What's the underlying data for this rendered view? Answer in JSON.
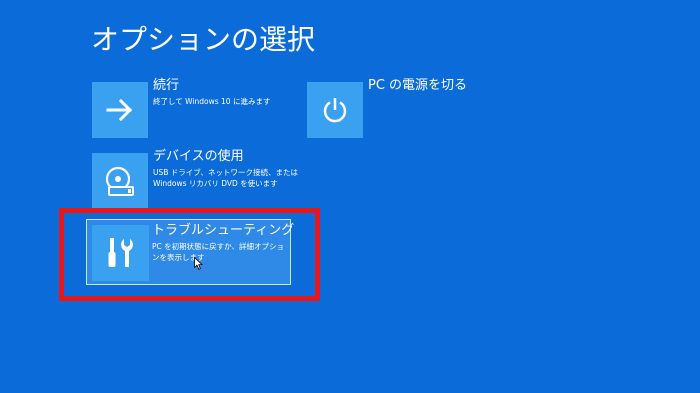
{
  "page": {
    "title": "オプションの選択"
  },
  "options": {
    "continue": {
      "title": "続行",
      "description": "終了して Windows 10 に進みます",
      "icon": "arrow-right-icon"
    },
    "power_off": {
      "title": "PC の電源を切る",
      "icon": "power-icon"
    },
    "use_device": {
      "title": "デバイスの使用",
      "description": "USB ドライブ、ネットワーク接続、または Windows リカバリ DVD を使います",
      "icon": "disc-drive-icon"
    },
    "troubleshoot": {
      "title": "トラブルシューティング",
      "description": "PC を初期状態に戻すか、詳細オプションを表示します",
      "icon": "tools-icon",
      "selected": true
    }
  },
  "colors": {
    "background": "#0b6cd9",
    "tile": "#3aa0f0",
    "selected_tile_bg": "#2e8ae6",
    "annotation_box": "#e8161b"
  }
}
